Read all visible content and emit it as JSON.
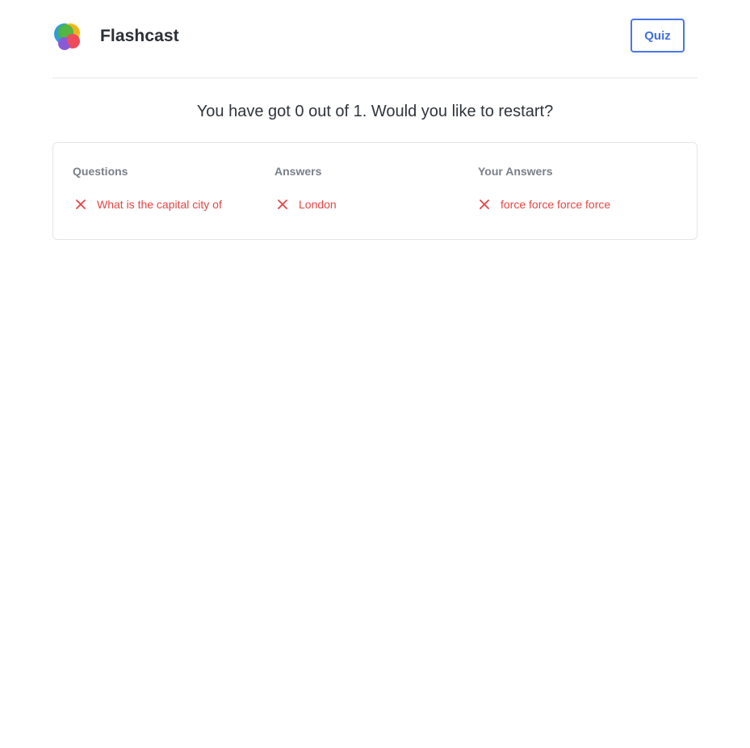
{
  "header": {
    "brand": "Flashcast",
    "logo_icon": "flashcast-logo-icon",
    "quiz_button_label": "Quiz"
  },
  "result": {
    "message": "You have got 0 out of 1. Would you like to restart?"
  },
  "results_table": {
    "columns": [
      "Questions",
      "Answers",
      "Your Answers"
    ],
    "rows": [
      {
        "question": "What is the capital city of",
        "answer": "London",
        "your_answer": "force force force force",
        "status_icon": "close-x-icon"
      }
    ]
  },
  "colors": {
    "accent": "#4a77e6",
    "incorrect": "#e64545",
    "muted": "#7a8089"
  }
}
